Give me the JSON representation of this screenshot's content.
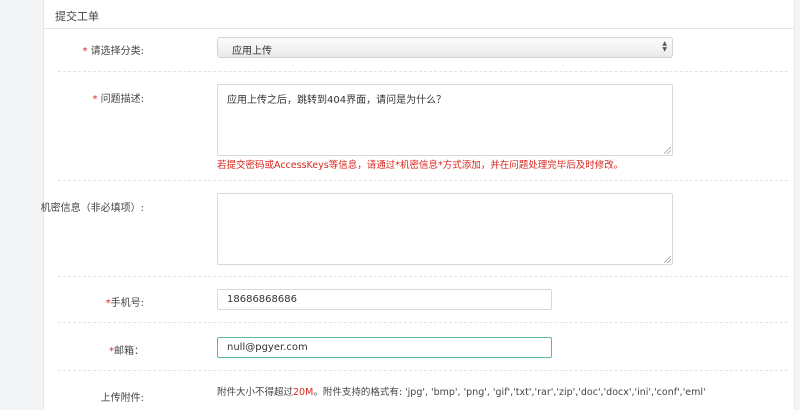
{
  "form": {
    "title": "提交工单",
    "category": {
      "required_mark": "*",
      "label": " 请选择分类:",
      "value": "应用上传"
    },
    "description": {
      "required_mark": "*",
      "label": " 问题描述:",
      "value": "应用上传之后，跳转到404界面，请问是为什么？"
    },
    "warning": "若提交密码或AccessKeys等信息，请通过*机密信息*方式添加，并在问题处理完毕后及时修改。",
    "confidential": {
      "label": "机密信息（非必填项）:",
      "value": ""
    },
    "phone": {
      "required_mark": "*",
      "label": "手机号:",
      "value": "18686868686"
    },
    "email": {
      "required_mark": "*",
      "label": "邮箱：",
      "value": "null@pgyer.com"
    },
    "attachment": {
      "label": "上传附件:",
      "note_prefix": "附件大小不得超过",
      "note_limit": "20M",
      "note_suffix": "。附件支持的格式有: 'jpg', 'bmp', 'png', 'gif','txt','rar','zip','doc','docx','ini','conf','eml'"
    }
  },
  "colors": {
    "required": "#d9251d",
    "focus_border": "#5fb8a3"
  }
}
